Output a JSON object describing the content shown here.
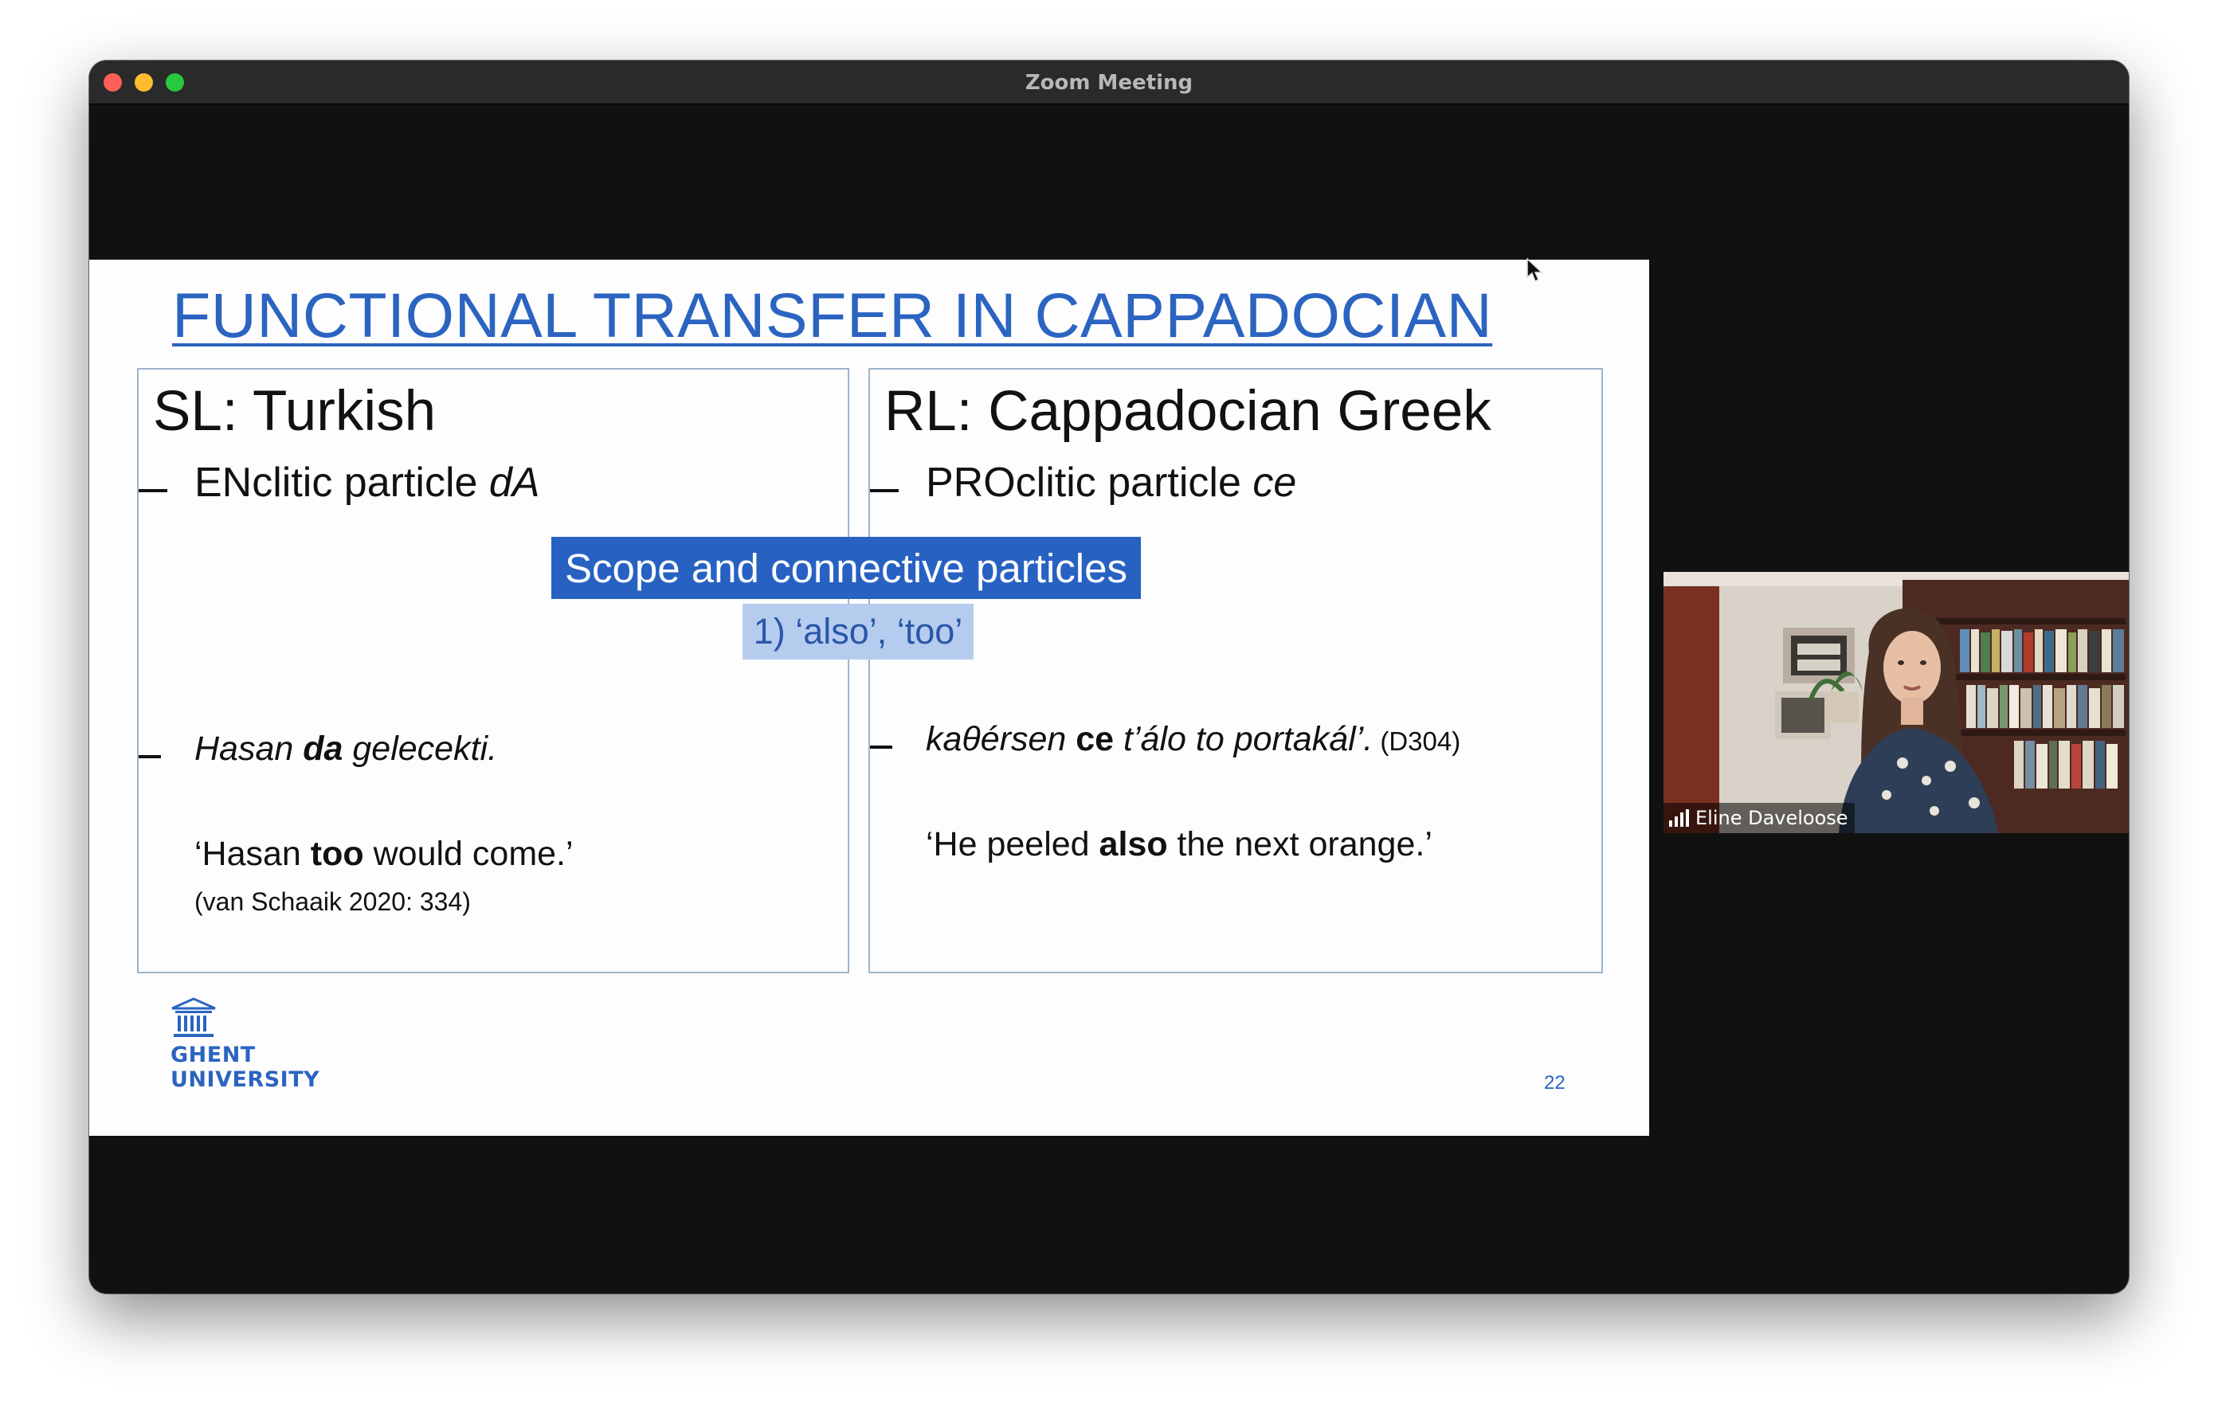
{
  "window": {
    "title": "Zoom Meeting"
  },
  "slide": {
    "title": "FUNCTIONAL TRANSFER IN CAPPADOCIAN",
    "left": {
      "heading": "SL: Turkish",
      "bullet_prefix": "ENclitic particle ",
      "bullet_italic": "dA",
      "example_pre": "Hasan ",
      "example_bold": "da",
      "example_post": " gelecekti.",
      "translation_pre": "‘Hasan ",
      "translation_bold": "too",
      "translation_post": " would come.’",
      "citation": "(van Schaaik 2020: 334)"
    },
    "right": {
      "heading": "RL: Cappadocian Greek",
      "bullet_prefix": "PROclitic particle ",
      "bullet_italic": "ce",
      "example_pre": "kaθérsen ",
      "example_bold": "ce",
      "example_post": " t’álo to portakál’.",
      "example_ref": " (D304)",
      "translation_pre": "‘He peeled ",
      "translation_bold": "also",
      "translation_post": " the next orange.’"
    },
    "overlay_main": "Scope and connective particles",
    "overlay_sub": "1) ‘also’, ‘too’",
    "logo_line1": "GHENT",
    "logo_line2": "UNIVERSITY",
    "page_number": "22"
  },
  "participant": {
    "name": "Eline Daveloose"
  },
  "colors": {
    "accent_blue": "#2b64c1",
    "overlay_blue": "#2762c2",
    "overlay_light": "#b5ccef"
  }
}
